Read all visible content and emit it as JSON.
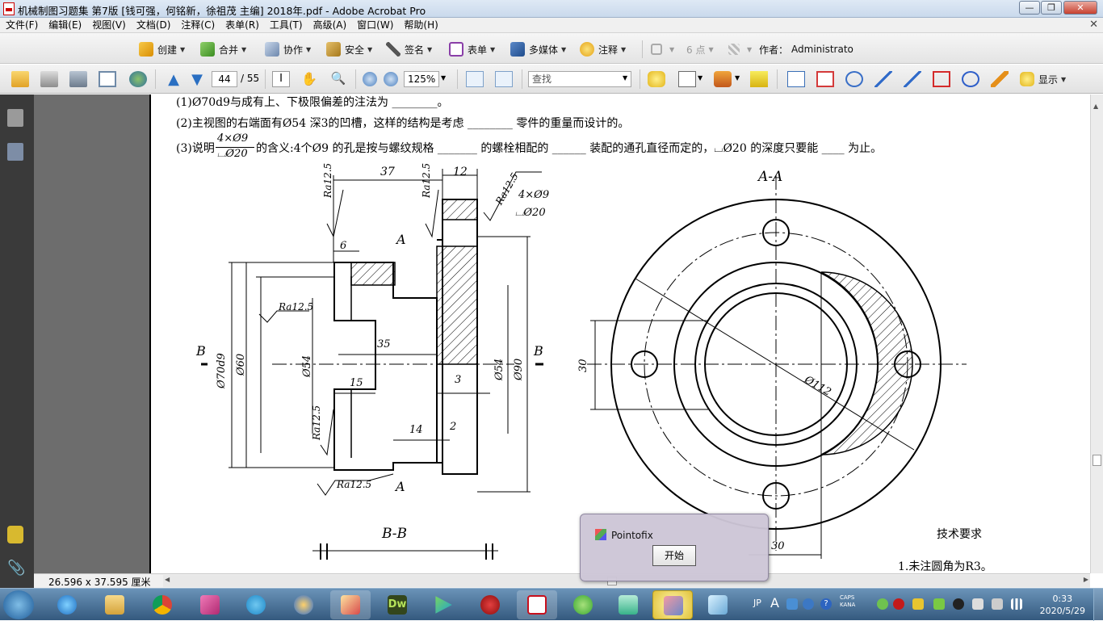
{
  "window": {
    "title": "机械制图习题集 第7版 [钱可强，何铭新，徐祖茂 主编] 2018年.pdf - Adobe Acrobat Pro",
    "minimize_glyph": "—",
    "maximize_glyph": "❐",
    "close_glyph": "✕"
  },
  "menu": {
    "items": [
      "文件(F)",
      "编辑(E)",
      "视图(V)",
      "文档(D)",
      "注释(C)",
      "表单(R)",
      "工具(T)",
      "高级(A)",
      "窗口(W)",
      "帮助(H)"
    ],
    "close_glyph": "✕"
  },
  "task_toolbar": {
    "create": "创建",
    "combine": "合并",
    "collaborate": "协作",
    "secure": "安全",
    "sign": "签名",
    "forms": "表单",
    "multimedia": "多媒体",
    "comment": "注释",
    "font_size": "6 点",
    "author_label": "作者：",
    "author_value": "Administrato"
  },
  "nav_toolbar": {
    "page_current": "44",
    "page_total": "/ 55",
    "zoom": "125%",
    "search_placeholder": "查找",
    "show": "显示"
  },
  "document": {
    "line1": "(1)Ø70d9与成有上、下极限偏差的注法为 ________。",
    "line2": "(2)主视图的右端面有Ø54 深3的凹槽，这样的结构是考虑 ________ 零件的重量而设计的。",
    "line3_pre": "(3)说明",
    "line3_frac_top": "4×Ø9",
    "line3_frac_bottom": "⌴Ø20",
    "line3_post": "的含义:4个Ø9 的孔是按与螺纹规格 _______ 的螺栓相配的 ______ 装配的通孔直径而定的，⌴Ø20 的深度只要能 ____ 为止。",
    "drawing": {
      "dim_37": "37",
      "dim_12": "12",
      "ra_top_left": "Ra12.5",
      "ra_top_mid": "Ra12.5",
      "ra_top_right": "Ra12.5",
      "hole_top": "4×Ø9",
      "hole_bottom": "⌴Ø20",
      "dim_6": "6",
      "section_a_top": "A",
      "ra_left": "Ra12.5",
      "dim_phi54_left": "Ø54",
      "dim_phi60": "Ø60",
      "dim_phi70d9": "Ø70d9",
      "cut_b_left": "B",
      "dim_35": "35",
      "dim_phi54_right": "Ø54",
      "dim_phi90": "Ø90",
      "cut_b_right": "B",
      "dim_3": "3",
      "dim_15": "15",
      "ra_lower_left": "Ra12.5",
      "dim_14": "14",
      "dim_2": "2",
      "ra_bottom": "Ra12.5",
      "section_a_bottom": "A",
      "view_bb": "B-B",
      "view_aa": "A-A",
      "dim_30_left": "30",
      "dim_phi112": "Ø112",
      "dim_30_bottom": "30",
      "tech_title": "技术要求",
      "tech_note1": "1.未注圆角为R3。"
    }
  },
  "status": {
    "page_size": "26.596 x 37.595 厘米"
  },
  "popup": {
    "app_name": "Pointofix",
    "start_button": "开始"
  },
  "taskbar": {
    "apps": [
      "start-orb",
      "internet-explorer",
      "file-explorer",
      "chrome",
      "app-pink",
      "telegram",
      "app-globe",
      "paint",
      "dreamweaver",
      "player",
      "flash",
      "acrobat",
      "wechat",
      "notes",
      "pointofix",
      "app-cube"
    ],
    "ime": "JP",
    "caps": "CAPS",
    "kana": "KANA",
    "time": "0:33",
    "date": "2020/5/29"
  },
  "colors": {
    "accent": "#2c5a86",
    "acrobat_red": "#c8101d",
    "popup_bg": "#cdc6d6"
  }
}
